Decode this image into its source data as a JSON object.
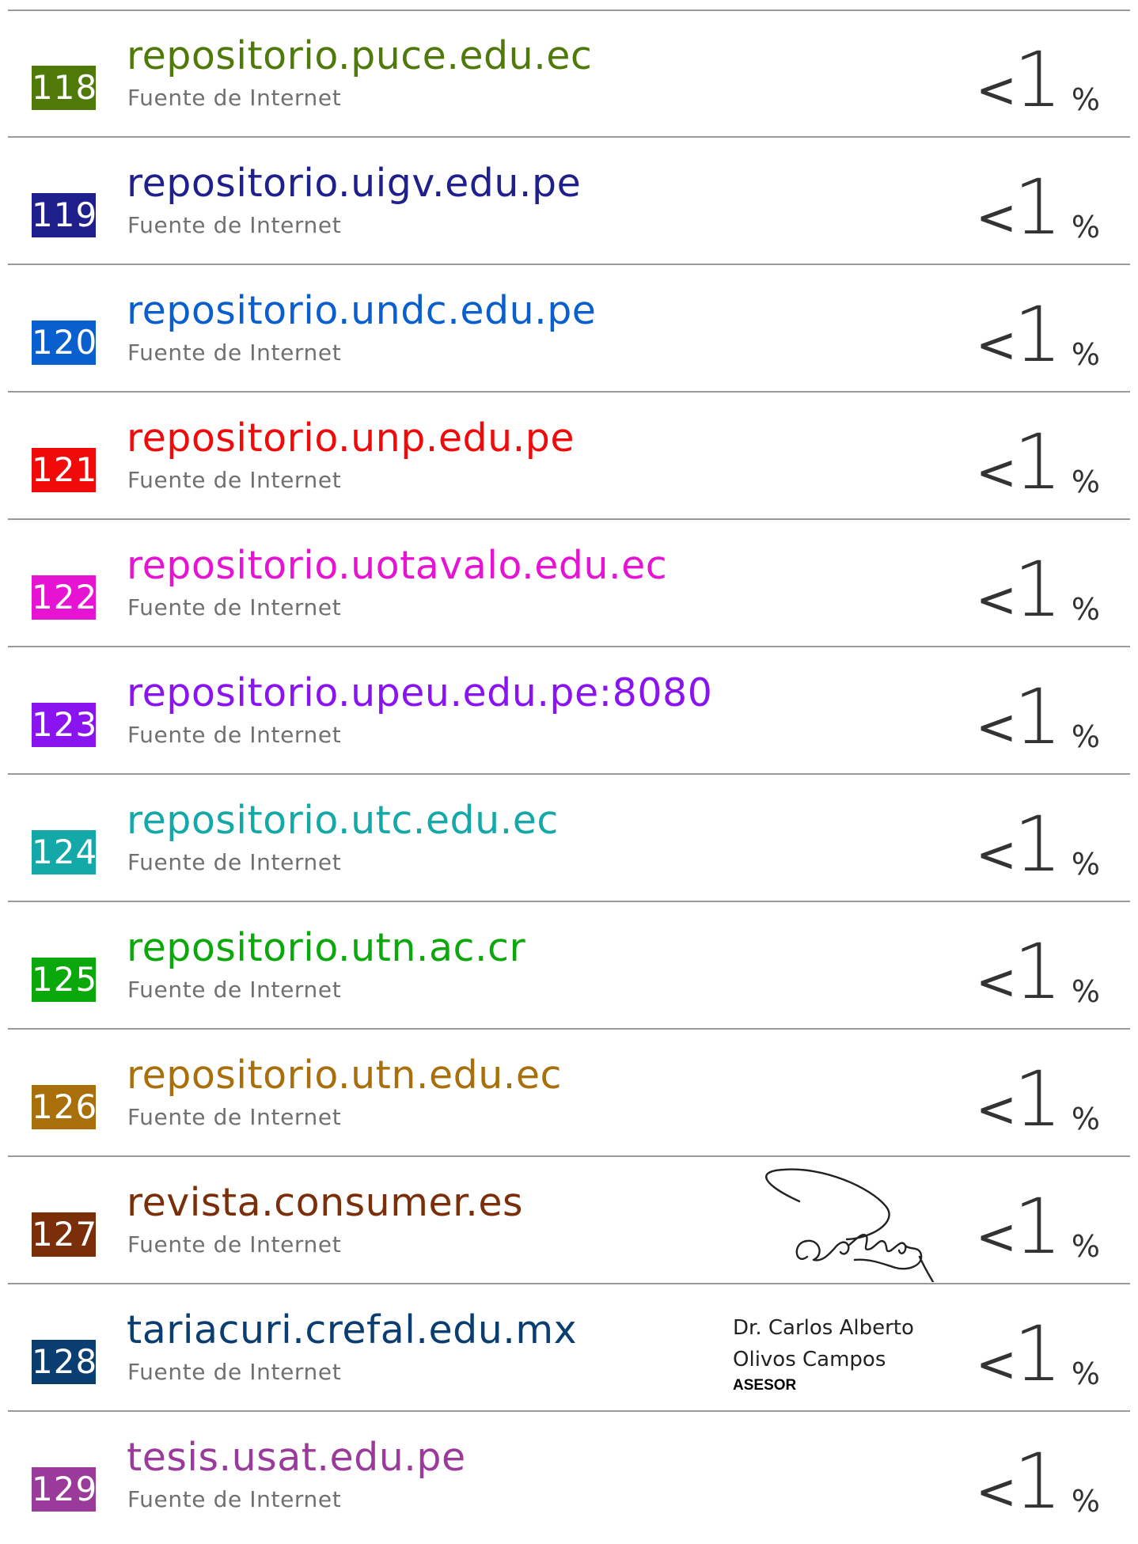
{
  "sources": [
    {
      "number": "118",
      "title": "repositorio.puce.edu.ec",
      "subtitle": "Fuente de Internet",
      "percent": {
        "prefix": "<",
        "value": "1",
        "suffix": "%"
      },
      "color": "#4f7a0a"
    },
    {
      "number": "119",
      "title": "repositorio.uigv.edu.pe",
      "subtitle": "Fuente de Internet",
      "percent": {
        "prefix": "<",
        "value": "1",
        "suffix": "%"
      },
      "color": "#20208c"
    },
    {
      "number": "120",
      "title": "repositorio.undc.edu.pe",
      "subtitle": "Fuente de Internet",
      "percent": {
        "prefix": "<",
        "value": "1",
        "suffix": "%"
      },
      "color": "#0a5fcf"
    },
    {
      "number": "121",
      "title": "repositorio.unp.edu.pe",
      "subtitle": "Fuente de Internet",
      "percent": {
        "prefix": "<",
        "value": "1",
        "suffix": "%"
      },
      "color": "#f00a0a"
    },
    {
      "number": "122",
      "title": "repositorio.uotavalo.edu.ec",
      "subtitle": "Fuente de Internet",
      "percent": {
        "prefix": "<",
        "value": "1",
        "suffix": "%"
      },
      "color": "#e614d2"
    },
    {
      "number": "123",
      "title": "repositorio.upeu.edu.pe:8080",
      "subtitle": "Fuente de Internet",
      "percent": {
        "prefix": "<",
        "value": "1",
        "suffix": "%"
      },
      "color": "#8a14f0"
    },
    {
      "number": "124",
      "title": "repositorio.utc.edu.ec",
      "subtitle": "Fuente de Internet",
      "percent": {
        "prefix": "<",
        "value": "1",
        "suffix": "%"
      },
      "color": "#14a8a8"
    },
    {
      "number": "125",
      "title": "repositorio.utn.ac.cr",
      "subtitle": "Fuente de Internet",
      "percent": {
        "prefix": "<",
        "value": "1",
        "suffix": "%"
      },
      "color": "#0aa80a"
    },
    {
      "number": "126",
      "title": "repositorio.utn.edu.ec",
      "subtitle": "Fuente de Internet",
      "percent": {
        "prefix": "<",
        "value": "1",
        "suffix": "%"
      },
      "color": "#a86f0a"
    },
    {
      "number": "127",
      "title": "revista.consumer.es",
      "subtitle": "Fuente de Internet",
      "percent": {
        "prefix": "<",
        "value": "1",
        "suffix": "%"
      },
      "color": "#7a2e0a"
    },
    {
      "number": "128",
      "title": "tariacuri.crefal.edu.mx",
      "subtitle": "Fuente de Internet",
      "percent": {
        "prefix": "<",
        "value": "1",
        "suffix": "%"
      },
      "color": "#0a3d70"
    },
    {
      "number": "129",
      "title": "tesis.usat.edu.pe",
      "subtitle": "Fuente de Internet",
      "percent": {
        "prefix": "<",
        "value": "1",
        "suffix": "%"
      },
      "color": "#9a3a9a"
    }
  ],
  "advisor": {
    "name_line_1": "Dr. Carlos Alberto",
    "name_line_2": "Olivos Campos",
    "role": "ASESOR"
  },
  "signature_icon": "handwritten-signature"
}
